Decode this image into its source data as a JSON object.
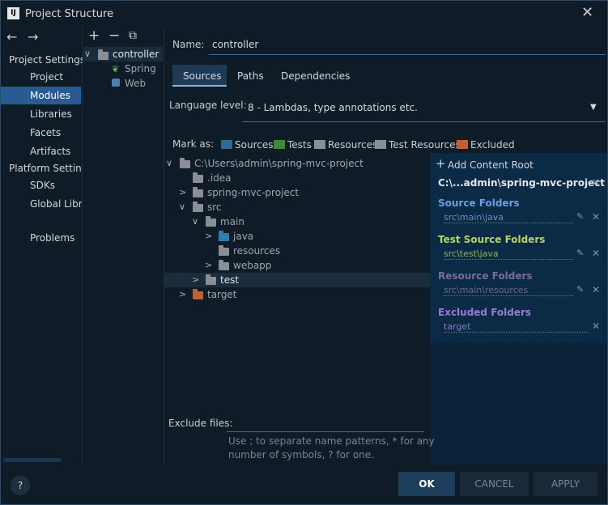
{
  "window": {
    "title": "Project Structure",
    "close_glyph": "✕",
    "app_icon_text": "IJ"
  },
  "nav": {
    "back": "←",
    "forward": "→",
    "sections": [
      {
        "label": "Project Settings"
      },
      {
        "label": "Project"
      },
      {
        "label": "Modules"
      },
      {
        "label": "Libraries"
      },
      {
        "label": "Facets"
      },
      {
        "label": "Artifacts"
      },
      {
        "label": "Platform Settings"
      },
      {
        "label": "SDKs"
      },
      {
        "label": "Global Libra"
      },
      {
        "label": "Problems"
      }
    ]
  },
  "modules": {
    "toolbar": {
      "add": "+",
      "remove": "−",
      "copy": "⧉"
    },
    "items": [
      {
        "label": "controller"
      },
      {
        "label": "Spring"
      },
      {
        "label": "Web"
      }
    ]
  },
  "form": {
    "name_label": "Name:",
    "name_value": "controller",
    "tabs": [
      {
        "label": "Sources"
      },
      {
        "label": "Paths"
      },
      {
        "label": "Dependencies"
      }
    ],
    "language_level_label": "Language level:",
    "language_level_value": "8 - Lambdas, type annotations etc.",
    "mark_as_label": "Mark as:",
    "mark_as": [
      {
        "label": "Sources",
        "color": "#2f6a93"
      },
      {
        "label": "Tests",
        "color": "#3f8a3a"
      },
      {
        "label": "Resources",
        "color": "#8a8f95"
      },
      {
        "label": "Test Resources",
        "color": "#8a8f95"
      },
      {
        "label": "Excluded",
        "color": "#c06030"
      }
    ],
    "exclude_label": "Exclude files:",
    "exclude_hint_1": "Use ; to separate name patterns, * for any",
    "exclude_hint_2": "number of symbols, ? for one."
  },
  "tree": [
    {
      "label": "C:\\Users\\admin\\spring-mvc-project",
      "arrow": "∨",
      "color": "#8a8f95"
    },
    {
      "label": ".idea",
      "arrow": "",
      "color": "#8a8f95"
    },
    {
      "label": "spring-mvc-project",
      "arrow": ">",
      "color": "#8a8f95"
    },
    {
      "label": "src",
      "arrow": "∨",
      "color": "#8a8f95"
    },
    {
      "label": "main",
      "arrow": "∨",
      "color": "#8a8f95"
    },
    {
      "label": "java",
      "arrow": ">",
      "color": "#2f7fae"
    },
    {
      "label": "resources",
      "arrow": "",
      "color": "#8a8f95"
    },
    {
      "label": "webapp",
      "arrow": ">",
      "color": "#8a8f95"
    },
    {
      "label": "test",
      "arrow": ">",
      "color": "#8a8f95"
    },
    {
      "label": "target",
      "arrow": ">",
      "color": "#c06030"
    }
  ],
  "content_root": {
    "add_label": "Add Content Root",
    "root_path": "C:\\...admin\\spring-mvc-project",
    "groups": [
      {
        "heading": "Source Folders",
        "path": "src\\main\\java",
        "head_color": "#6f9fe0",
        "path_color": "#5f8fc8"
      },
      {
        "heading": "Test Source Folders",
        "path": "src\\test\\java",
        "head_color": "#b7d46a",
        "path_color": "#8db55a"
      },
      {
        "heading": "Resource Folders",
        "path": "src\\main\\resources",
        "head_color": "#7a6a9a",
        "path_color": "#6e6486"
      },
      {
        "heading": "Excluded Folders",
        "path": "target",
        "head_color": "#9a7ad8",
        "path_color": "#8a7ac8"
      }
    ]
  },
  "buttons": {
    "help": "?",
    "ok": "OK",
    "cancel": "CANCEL",
    "apply": "APPLY"
  }
}
